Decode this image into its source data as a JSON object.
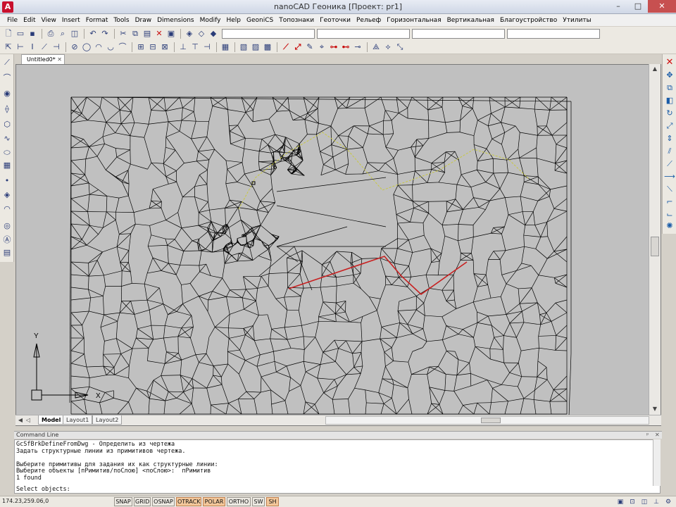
{
  "window": {
    "title": "nanoCAD Геоника [Проект: pr1]",
    "logo": "A",
    "min": "–",
    "max": "□",
    "close": "✕"
  },
  "menu": [
    "File",
    "Edit",
    "View",
    "Insert",
    "Format",
    "Tools",
    "Draw",
    "Dimensions",
    "Modify",
    "Help",
    "GeoniCS",
    "Топознаки",
    "Геоточки",
    "Рельеф",
    "Горизонтальная",
    "Вертикальная",
    "Благоустройство",
    "Утилиты"
  ],
  "doc_tab": {
    "label": "Untitled0*",
    "close": "✕"
  },
  "layout_tabs": [
    "Model",
    "Layout1",
    "Layout2"
  ],
  "command": {
    "header": "Command Line",
    "pin": "ᵖ",
    "close": "✕",
    "lines": [
      "GcSfBrkDefineFromDwg - Определить из чертежа",
      "Задать структурные линии из примитивов чертежа.",
      "",
      "Выберите примитивы для задания их как структурные линии:",
      "Выберите объекты [пРимитив/поСлою] <поСлою>:  пРимитив",
      "1 found"
    ],
    "prompt": "Select objects:"
  },
  "status": {
    "coords": "174.23,259.06,0",
    "buttons": [
      {
        "label": "SNAP",
        "on": false
      },
      {
        "label": "GRID",
        "on": false
      },
      {
        "label": "OSNAP",
        "on": false
      },
      {
        "label": "OTRACK",
        "on": true
      },
      {
        "label": "POLAR",
        "on": true
      },
      {
        "label": "ORTHO",
        "on": false
      },
      {
        "label": "SW",
        "on": false
      },
      {
        "label": "SH",
        "on": true
      }
    ]
  },
  "ucs": {
    "x_label": "X",
    "y_label": "Y"
  },
  "colors": {
    "canvas": "#c0c0c0",
    "mesh": "#000000",
    "breakline": "#c82020",
    "contour": "#c8c840",
    "status_on": "#f3c79a"
  }
}
